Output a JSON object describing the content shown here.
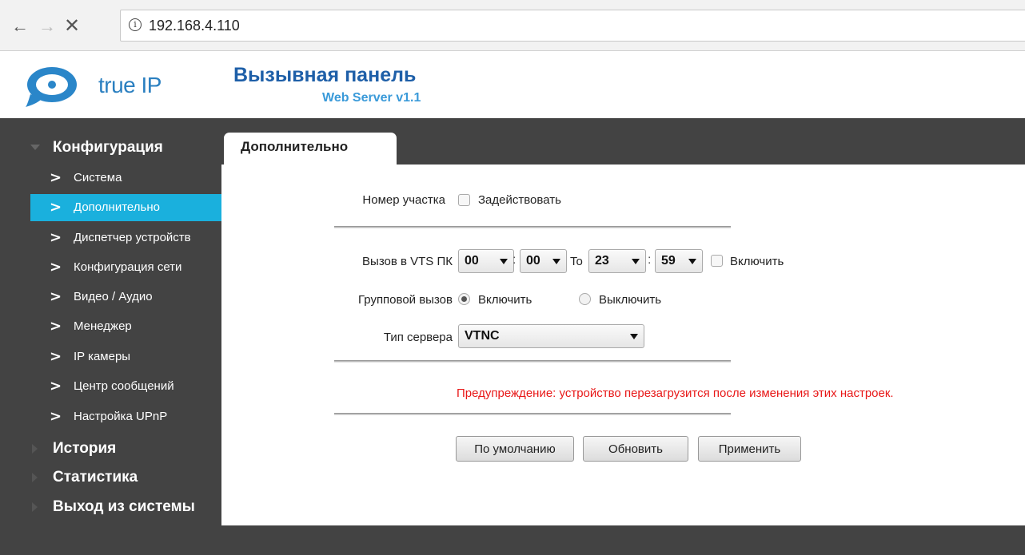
{
  "browser": {
    "url": "192.168.4.110"
  },
  "header": {
    "logo_text": "true IP",
    "title": "Вызывная панель",
    "subtitle": "Web Server v1.1",
    "brand_color": "#2a7fc0"
  },
  "sidebar": {
    "sections": [
      {
        "label": "Конфигурация",
        "expanded": true
      },
      {
        "label": "История",
        "expanded": false
      },
      {
        "label": "Статистика",
        "expanded": false
      },
      {
        "label": "Выход из системы",
        "expanded": false
      }
    ],
    "items": [
      {
        "label": "Система",
        "active": false
      },
      {
        "label": "Дополнительно",
        "active": true
      },
      {
        "label": "Диспетчер устройств",
        "active": false
      },
      {
        "label": "Конфигурация сети",
        "active": false
      },
      {
        "label": "Видео / Аудио",
        "active": false
      },
      {
        "label": "Менеджер",
        "active": false
      },
      {
        "label": "IP камеры",
        "active": false
      },
      {
        "label": "Центр сообщений",
        "active": false
      },
      {
        "label": "Настройка UPnP",
        "active": false
      }
    ],
    "active_color": "#1ab0dd"
  },
  "tab": {
    "label": "Дополнительно"
  },
  "form": {
    "section_number": {
      "label": "Номер участка",
      "checkbox_label": "Задействовать",
      "checked": false
    },
    "vts_call": {
      "label": "Вызов в VTS ПК",
      "from_hour": "00",
      "from_minute": "00",
      "to_label": "To",
      "to_hour": "23",
      "to_minute": "59",
      "colon": ":",
      "enable_label": "Включить",
      "checked": false
    },
    "group_call": {
      "label": "Групповой вызов",
      "on_label": "Включить",
      "off_label": "Выключить",
      "selected": "on"
    },
    "server_type": {
      "label": "Тип сервера",
      "value": "VTNC"
    },
    "warning": "Предупреждение: устройство перезагрузится после изменения этих настроек.",
    "warning_color": "#e81818",
    "buttons": {
      "default": "По умолчанию",
      "refresh": "Обновить",
      "apply": "Применить"
    }
  }
}
